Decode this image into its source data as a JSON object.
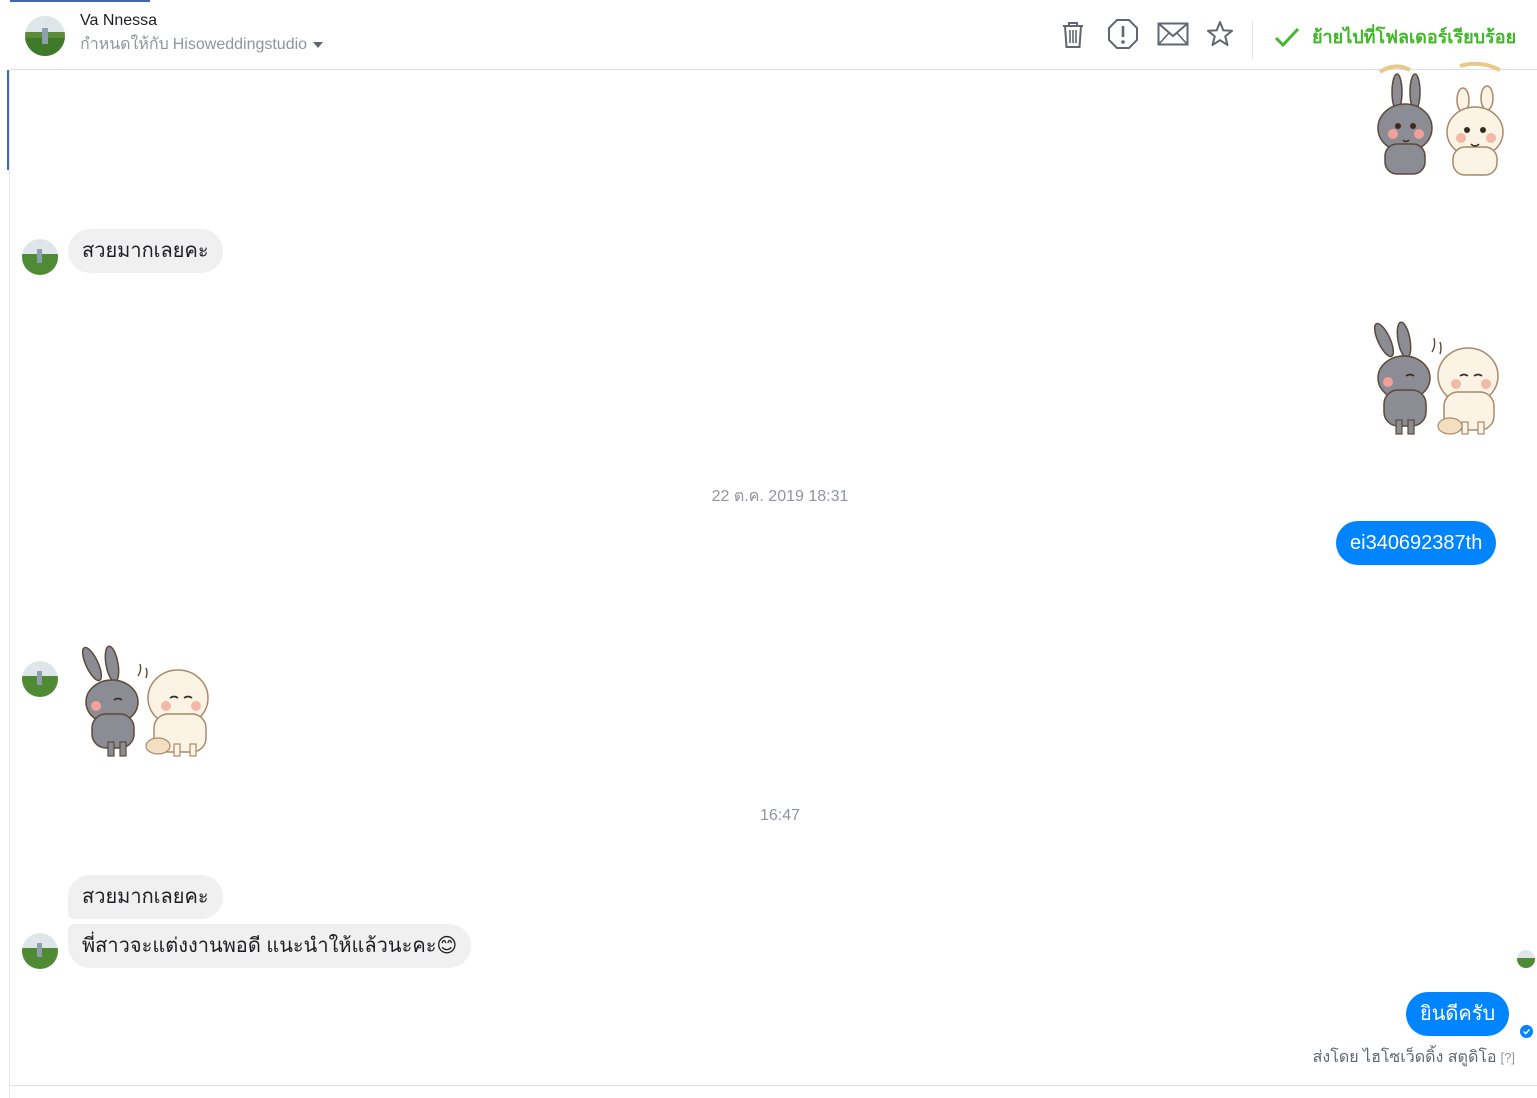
{
  "header": {
    "contact_name": "Va Nnessa",
    "assign_prefix": "กำหนดให้กับ",
    "assign_page": "Hisoweddingstudio",
    "done_label": "ย้ายไปที่โฟลเดอร์เรียบร้อย",
    "done_color": "#42b72a",
    "tools": [
      "trash-icon",
      "spam-icon",
      "mark-unread-icon",
      "star-icon"
    ]
  },
  "messages": {
    "m1_text": "สวยมากเลยคะ",
    "timestamp_1": "22 ต.ค. 2019 18:31",
    "m2_text": "ei340692387th",
    "timestamp_2": "16:47",
    "m3_text": "สวยมากเลยคะ",
    "m4_text": "พี่สาวจะแต่งงานพอดี แนะนำให้แล้วนะคะ😊",
    "m5_text": "ยินดีครับ"
  },
  "footer": {
    "sent_by": "ส่งโดย ไฮโซเว็ดดิ้ง สตูดิโอ",
    "help": "[?]"
  },
  "colors": {
    "outgoing_bubble": "#0084ff",
    "incoming_bubble": "#f1f0f0",
    "accent": "#4267b2"
  }
}
